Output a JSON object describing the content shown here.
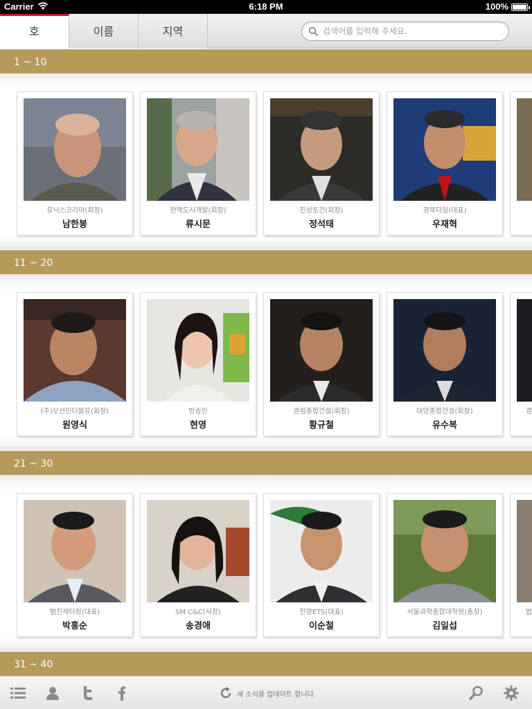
{
  "status_bar": {
    "carrier": "Carrier",
    "time": "6:18 PM",
    "battery": "100%"
  },
  "tabs": [
    {
      "label": "호",
      "active": true
    },
    {
      "label": "이름",
      "active": false
    },
    {
      "label": "지역",
      "active": false
    }
  ],
  "search": {
    "placeholder": "검색어를 입력해 주세요.",
    "value": ""
  },
  "sections": [
    {
      "header": "1 ~ 10",
      "people": [
        {
          "company": "유닉스코리아(회장)",
          "name": "남한봉"
        },
        {
          "company": "한맥도시개발(회장)",
          "name": "류시문"
        },
        {
          "company": "진성토건(회장)",
          "name": "정석태"
        },
        {
          "company": "경북타일(대표)",
          "name": "우재혁"
        }
      ]
    },
    {
      "header": "11 ~ 20",
      "people": [
        {
          "company": "(주)오션인더블유(회장)",
          "name": "원영식"
        },
        {
          "company": "방송인",
          "name": "현영"
        },
        {
          "company": "경림종합건설(회장)",
          "name": "황규철"
        },
        {
          "company": "대양종합건설(회장)",
          "name": "유수복"
        },
        {
          "company": "경",
          "name": ""
        }
      ]
    },
    {
      "header": "21 ~ 30",
      "people": [
        {
          "company": "범진캐터링(대표)",
          "name": "박홍순"
        },
        {
          "company": "SM C&C(사장)",
          "name": "송경애"
        },
        {
          "company": "진영ETS(대표)",
          "name": "이순철"
        },
        {
          "company": "서울과학종합대학원(총장)",
          "name": "김일섭"
        },
        {
          "company": "법",
          "name": ""
        }
      ]
    },
    {
      "header": "31 ~ 40",
      "people": []
    }
  ],
  "toolbar": {
    "update_text": "새 소식을 업데이트 합니다.",
    "icons": [
      "list-icon",
      "person-icon",
      "twitter-icon",
      "facebook-icon",
      "refresh-icon",
      "search-icon",
      "gear-icon"
    ]
  },
  "colors": {
    "section_header": "#b59a5a",
    "active_tab_accent": "#c8161d"
  }
}
